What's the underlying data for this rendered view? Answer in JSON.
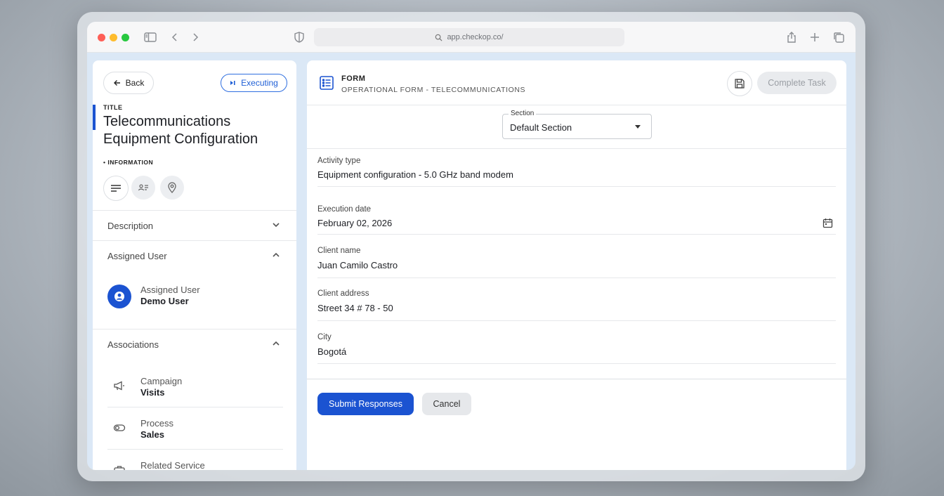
{
  "browser": {
    "url": "app.checkop.co/"
  },
  "task": {
    "back_label": "Back",
    "status_label": "Executing",
    "title_label": "TITLE",
    "title": "Telecommunications Equipment Configuration",
    "info_label": "• INFORMATION"
  },
  "accordion": {
    "description": "Description",
    "assigned_user": "Assigned User",
    "associations": "Associations"
  },
  "assigned": {
    "label": "Assigned User",
    "value": "Demo User"
  },
  "associations": [
    {
      "label": "Campaign",
      "value": "Visits",
      "icon": "megaphone-icon"
    },
    {
      "label": "Process",
      "value": "Sales",
      "icon": "toggle-icon"
    },
    {
      "label": "Related Service",
      "value": "",
      "icon": "briefcase-icon"
    }
  ],
  "form": {
    "label": "FORM",
    "subtitle": "OPERATIONAL FORM - TELECOMMUNICATIONS",
    "complete_label": "Complete Task",
    "section_legend": "Section",
    "section_value": "Default Section",
    "fields": [
      {
        "label": "Activity type",
        "value": "Equipment configuration - 5.0 GHz band modem"
      },
      {
        "label": "Execution date",
        "value": "February 02, 2026"
      },
      {
        "label": "Client name",
        "value": "Juan Camilo Castro"
      },
      {
        "label": "Client address",
        "value": "Street 34 # 78 - 50"
      },
      {
        "label": "City",
        "value": "Bogotá"
      }
    ],
    "submit_label": "Submit Responses",
    "cancel_label": "Cancel"
  },
  "colors": {
    "accent": "#1b53d1"
  }
}
